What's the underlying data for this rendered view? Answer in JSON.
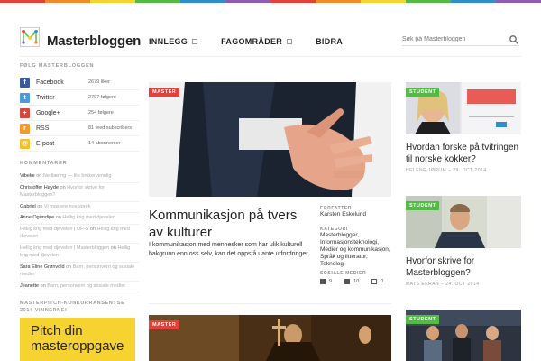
{
  "colors": {
    "top_stripes": [
      "#e5403a",
      "#f18a2b",
      "#f7d331",
      "#55b946",
      "#2f8fce",
      "#8e5bb5",
      "#e5403a",
      "#f18a2b",
      "#f7d331",
      "#55b946",
      "#2f8fce",
      "#8e5bb5"
    ],
    "tag_red": "#e5403a",
    "tag_green": "#55b946",
    "promo_yellow": "#f7d331"
  },
  "header": {
    "logo_text": "Masterbloggen",
    "nav": [
      {
        "label": "INNLEGG",
        "has_dropdown": true
      },
      {
        "label": "FAGOMRÅDER",
        "has_dropdown": true
      },
      {
        "label": "BIDRA",
        "has_dropdown": false
      }
    ],
    "search_placeholder": "Søk på Masterbloggen"
  },
  "sidebar": {
    "follow_heading": "FØLG MASTERBLOGGEN",
    "social": [
      {
        "name": "Facebook",
        "count": "2679 liker",
        "color": "#3b5998",
        "icon": "f"
      },
      {
        "name": "Twitter",
        "count": "2797 følgere",
        "color": "#4a9bd6",
        "icon": "t"
      },
      {
        "name": "Google+",
        "count": "254 følgere",
        "color": "#d9473a",
        "icon": "+"
      },
      {
        "name": "RSS",
        "count": "81 feed subscribers",
        "color": "#f39a2b",
        "icon": "r"
      },
      {
        "name": "E-post",
        "count": "14 abonnenter",
        "color": "#f3c12b",
        "icon": "@"
      }
    ],
    "comments_heading": "KOMMENTARER",
    "comments": [
      {
        "author": "Vibeke",
        "on": "on",
        "post": "Nettlæring — lite brukervennlig"
      },
      {
        "author": "Christoffer Høyde",
        "on": "on",
        "post": "Hvorfor skrive for Masterbloggen?"
      },
      {
        "author": "Gabriel",
        "on": "on",
        "post": "Vi mastere nye sprek"
      },
      {
        "author": "Anne Ogundipe",
        "on": "on",
        "post": "Hellig krig med djevelen"
      },
      {
        "author": "Hellig krig med djevelen | OP-S",
        "on": "on",
        "post": "Hellig krig med djevelen"
      },
      {
        "author": "Hellig krig med djevelen | Masterbloggen",
        "on": "on",
        "post": "Hellig krig med djevelen"
      },
      {
        "author": "Sara Eline Grønvold",
        "on": "on",
        "post": "Barn, personvern og sosiale medier"
      },
      {
        "author": "Jeanette",
        "on": "on",
        "post": "Barn, personvern og sosiale medier"
      }
    ],
    "promo_heading": "MASTERPITCH-KONKURRANSEN: SE 2014 VINNERNE!",
    "promo_title": "Pitch din masteroppgave"
  },
  "main": {
    "tag": "MASTER",
    "title": "Kommunikasjon på tvers av kulturer",
    "excerpt": "I kommunikasjon med mennesker som har ulik kulturell bakgrunn enn oss selv, kan det oppstå uante utfordringer.",
    "author_label": "FORFATTER",
    "author": "Karsten Eskelund",
    "category_label": "KATEGORI",
    "categories": "Masterblogger, Informasjonsteknologi, Medier og kommunikasjon, Språk og litteratur, Teknologi",
    "social_label": "SOSIALE MEDIER",
    "stats": {
      "twitter": "9",
      "facebook": "10",
      "comments": "0"
    },
    "second_tag": "MASTER"
  },
  "right": [
    {
      "tag": "STUDENT",
      "title": "Hvordan forske på tvitringen til norske kokker?",
      "meta": "HELENE JØRUM – 29. OCT 2014"
    },
    {
      "tag": "STUDENT",
      "title": "Hvorfor skrive for Masterbloggen?",
      "meta": "MATS EKRAN – 24. OCT 2014"
    },
    {
      "tag": "STUDENT"
    }
  ]
}
